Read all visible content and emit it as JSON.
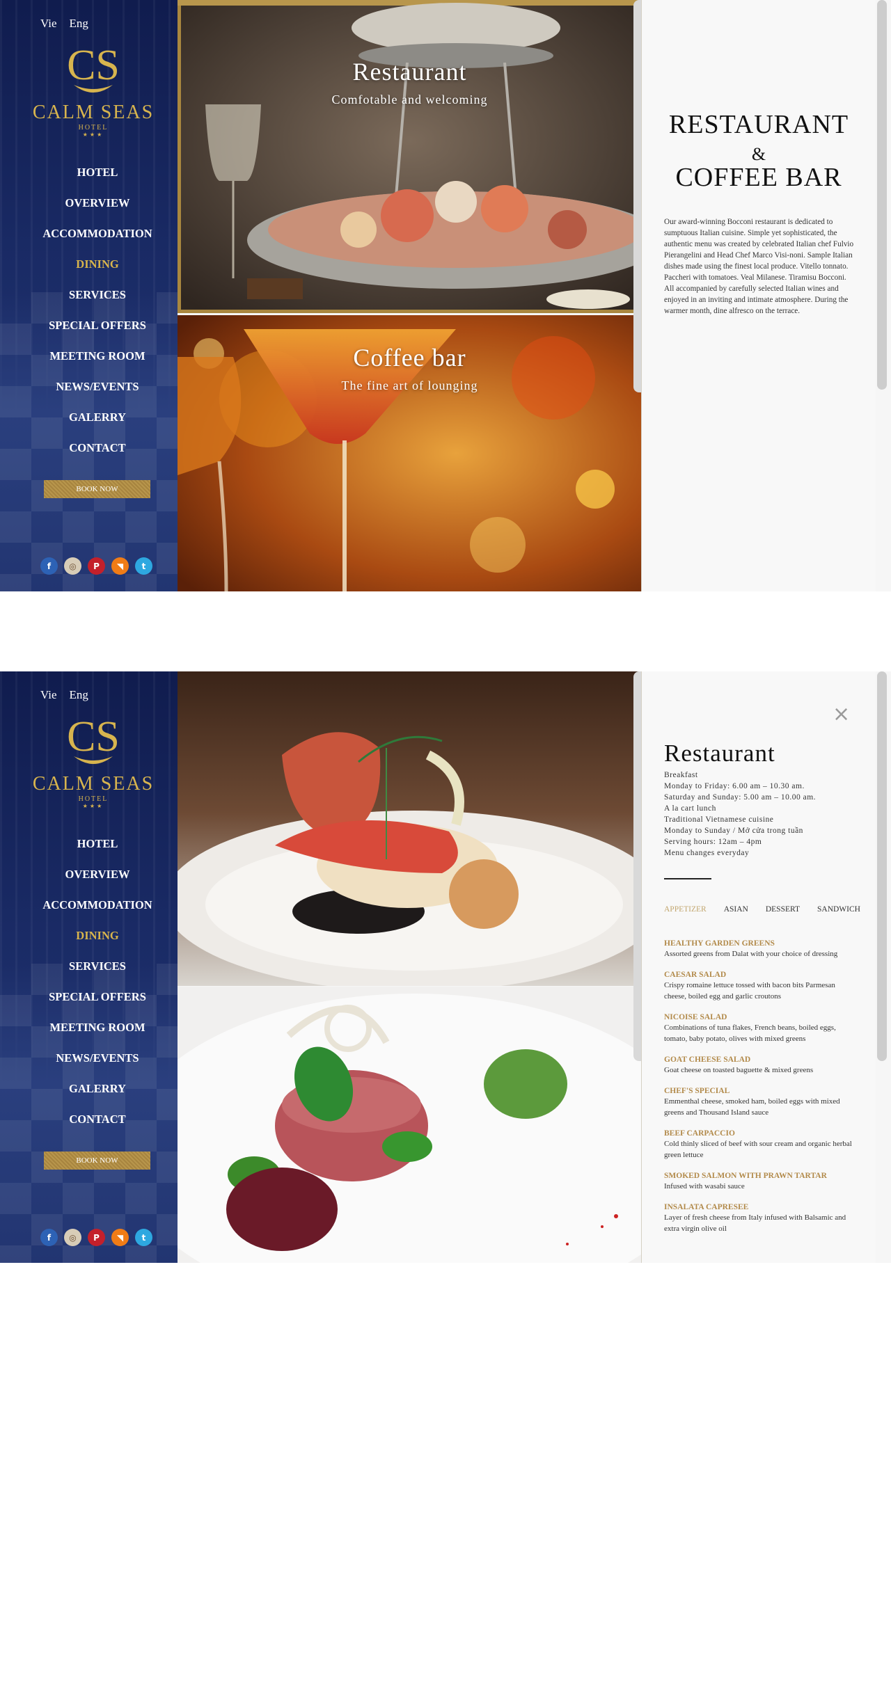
{
  "sidebar": {
    "lang": [
      "Vie",
      "Eng"
    ],
    "logo": {
      "mark": "CS",
      "name": "CALM SEAS",
      "sub": "HOTEL",
      "stars": "★★★"
    },
    "nav": [
      "HOTEL",
      "OVERVIEW",
      "ACCOMMODATION",
      "DINING",
      "SERVICES",
      "SPECIAL OFFERS",
      "MEETING ROOM",
      "NEWS/EVENTS",
      "GALERRY",
      "CONTACT"
    ],
    "active_nav": "DINING",
    "book_label": "BOOK NOW",
    "social_icons": [
      "facebook-icon",
      "instagram-icon",
      "pinterest-icon",
      "rss-icon",
      "twitter-icon"
    ],
    "social_glyphs": [
      "f",
      "◎",
      "P",
      "◥",
      "t"
    ]
  },
  "screen1": {
    "restaurant_title": "Restaurant",
    "restaurant_subtitle": "Comfotable and welcoming",
    "coffee_title": "Coffee bar",
    "coffee_subtitle": "The fine art of lounging",
    "panel": {
      "title_line1": "RESTAURANT",
      "amp": "&",
      "title_line2": "COFFEE BAR",
      "description": "Our award-winning Bocconi restaurant is dedicated to sumptuous Italian cuisine. Simple yet sophisticated, the authentic menu was created by celebrated Italian chef Fulvio Pierangelini and Head Chef Marco Visi-noni. Sample Italian dishes made using the finest local produce. Vitello tonnato. Paccheri with tomatoes. Veal Milanese. Tiramisu Bocconi. All accompanied by carefully selected Italian wines and enjoyed in an inviting and intimate atmosphere. During the warmer month, dine alfresco on the terrace."
    }
  },
  "screen2": {
    "close_icon": "×",
    "title": "Restaurant",
    "hours": [
      "Breakfast",
      "Monday to Friday: 6.00 am – 10.30 am.",
      "Saturday and Sunday: 5.00 am – 10.00 am.",
      "A la cart lunch",
      "Traditional Vietnamese cuisine",
      "Monday to Sunday / Mở cửa trong tuần",
      "Serving hours: 12am – 4pm",
      "Menu changes everyday"
    ],
    "tabs": [
      "APPETIZER",
      "ASIAN",
      "DESSERT",
      "SANDWICH"
    ],
    "active_tab": "APPETIZER",
    "menu": [
      {
        "name": "HEALTHY GARDEN GREENS",
        "desc": "Assorted greens from Dalat with your choice of dressing"
      },
      {
        "name": "CAESAR SALAD",
        "desc": "Crispy romaine lettuce tossed with bacon bits Parmesan cheese, boiled egg and garlic croutons"
      },
      {
        "name": "NICOISE SALAD",
        "desc": "Combinations of tuna flakes, French beans, boiled eggs, tomato, baby potato, olives with mixed greens"
      },
      {
        "name": "GOAT CHEESE SALAD",
        "desc": "Goat cheese on toasted baguette & mixed greens"
      },
      {
        "name": "CHEF'S SPECIAL",
        "desc": "Emmenthal cheese, smoked ham, boiled eggs with mixed greens and Thousand Island sauce"
      },
      {
        "name": "BEEF CARPACCIO",
        "desc": "Cold thinly sliced of beef with sour cream and organic herbal green lettuce"
      },
      {
        "name": "SMOKED SALMON WITH PRAWN TARTAR",
        "desc": "Infused with wasabi sauce"
      },
      {
        "name": "INSALATA CAPRESEE",
        "desc": "Layer of fresh cheese from Italy infused with Balsamic and extra virgin olive oil"
      }
    ]
  },
  "colors": {
    "navy": "#16255e",
    "gold": "#d7b44e",
    "menu_gold": "#b28a4a",
    "active_tab": "#c2a66e",
    "panel_bg": "#f8f8f8"
  }
}
